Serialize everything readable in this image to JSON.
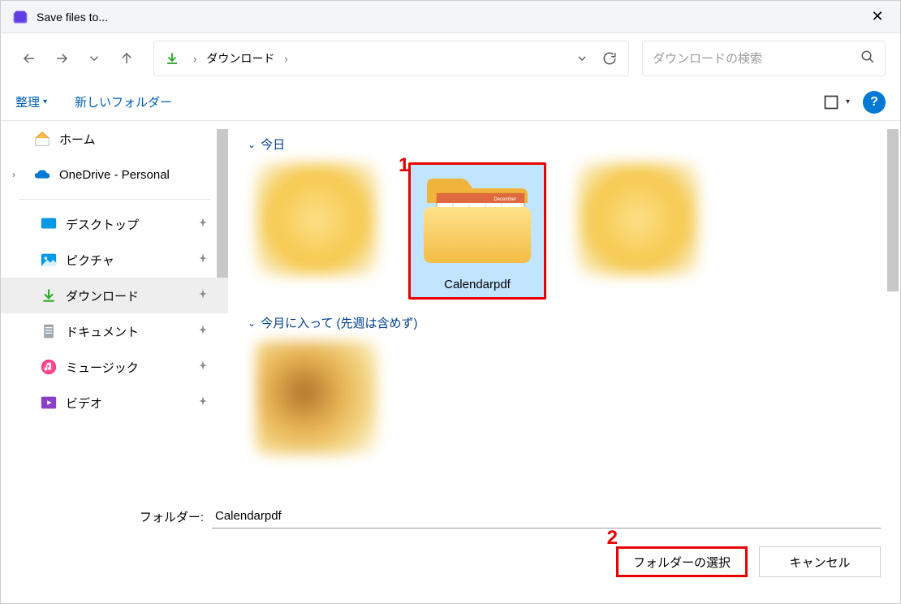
{
  "window": {
    "title": "Save files to...",
    "close_symbol": "✕"
  },
  "breadcrumb": {
    "location": "ダウンロード"
  },
  "search": {
    "placeholder": "ダウンロードの検索"
  },
  "toolbar": {
    "organize": "整理",
    "new_folder": "新しいフォルダー",
    "help_symbol": "?"
  },
  "sidebar": {
    "home": "ホーム",
    "onedrive": "OneDrive - Personal",
    "quick": {
      "desktop": "デスクトップ",
      "pictures": "ピクチャ",
      "downloads": "ダウンロード",
      "documents": "ドキュメント",
      "music": "ミュージック",
      "videos": "ビデオ"
    }
  },
  "content": {
    "groups": {
      "today": "今日",
      "earlier_this_month": "今月に入って (先週は含めず)"
    },
    "selected_folder_name": "Calendarpdf",
    "calendar_label": "December"
  },
  "footer": {
    "folder_label": "フォルダー:",
    "folder_value": "Calendarpdf",
    "select_button": "フォルダーの選択",
    "cancel_button": "キャンセル"
  },
  "annotations": {
    "step1": "1",
    "step2": "2"
  }
}
